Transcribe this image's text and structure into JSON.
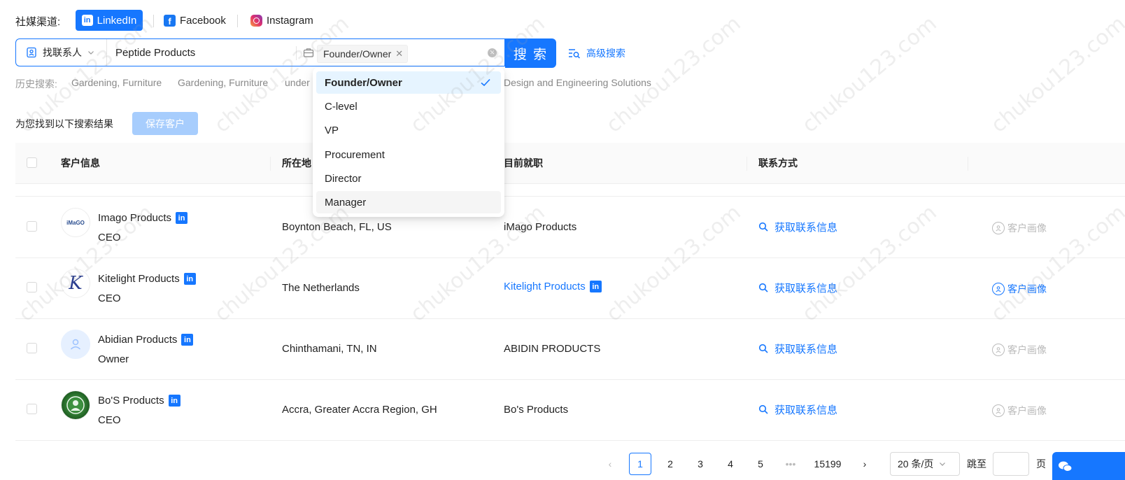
{
  "social": {
    "label": "社媒渠道:",
    "tabs": [
      {
        "label": "LinkedIn",
        "icon": "linkedin-icon",
        "active": true
      },
      {
        "label": "Facebook",
        "icon": "facebook-icon",
        "active": false
      },
      {
        "label": "Instagram",
        "icon": "instagram-icon",
        "active": false
      }
    ]
  },
  "search": {
    "type_label": "找联系人",
    "keyword": "Peptide Products",
    "selected_tag": "Founder/Owner",
    "button_label": "搜 索",
    "advanced_label": "高级搜索"
  },
  "history": {
    "label": "历史搜索:",
    "items": [
      "Gardening, Furniture",
      "Gardening, Furniture",
      "under",
      "Design and Engineering Solutions"
    ]
  },
  "results": {
    "label": "为您找到以下搜索结果",
    "save_label": "保存客户"
  },
  "table": {
    "headers": [
      "客户信息",
      "所在地",
      "目前就职",
      "联系方式"
    ],
    "rows": [
      {
        "name": "Imago Products",
        "title": "CEO",
        "location": "Boynton Beach, FL, US",
        "company": "iMago Products",
        "company_link": false,
        "contact": "获取联系信息",
        "portrait": "客户画像",
        "portrait_active": false,
        "avatar_text": "iMaGO"
      },
      {
        "name": "Kitelight Products",
        "title": "CEO",
        "location": "The Netherlands",
        "company": "Kitelight Products",
        "company_link": true,
        "contact": "获取联系信息",
        "portrait": "客户画像",
        "portrait_active": true,
        "avatar_text": "K"
      },
      {
        "name": "Abidian Products",
        "title": "Owner",
        "location": "Chinthamani, TN, IN",
        "company": "ABIDIN PRODUCTS",
        "company_link": false,
        "contact": "获取联系信息",
        "portrait": "客户画像",
        "portrait_active": false,
        "avatar_text": ""
      },
      {
        "name": "Bo'S Products",
        "title": "CEO",
        "location": "Accra, Greater Accra Region, GH",
        "company": "Bo's Products",
        "company_link": false,
        "contact": "获取联系信息",
        "portrait": "客户画像",
        "portrait_active": false,
        "avatar_text": ""
      }
    ]
  },
  "dropdown": {
    "options": [
      "Founder/Owner",
      "C-level",
      "VP",
      "Procurement",
      "Director",
      "Manager"
    ],
    "selected": "Founder/Owner",
    "hovered": "Manager"
  },
  "pagination": {
    "pages": [
      "1",
      "2",
      "3",
      "4",
      "5",
      "•••",
      "15199"
    ],
    "current": "1",
    "page_size": "20 条/页",
    "jump_label": "跳至",
    "page_suffix": "页"
  },
  "watermark": "chukou123.com",
  "colors": {
    "accent": "#1677ff",
    "save_disabled": "#a7cdfd"
  }
}
